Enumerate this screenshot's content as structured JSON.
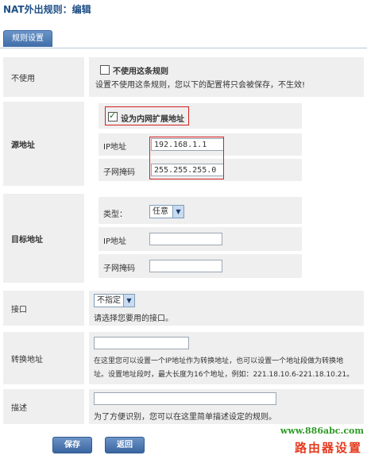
{
  "page": {
    "title": "NAT外出规则：编辑"
  },
  "tab": {
    "label": "规则设置"
  },
  "disable": {
    "label": "不使用",
    "checkbox_label": "不使用这条规则",
    "hint": "设置不使用这条规则，您以下的配置将只会被保存，不生效!"
  },
  "source": {
    "label": "源地址",
    "checkbox_label": "设为内网扩展地址",
    "ip_label": "IP地址",
    "ip_value": "192.168.1.1",
    "mask_label": "子网掩码",
    "mask_value": "255.255.255.0"
  },
  "target": {
    "label": "目标地址",
    "type_label": "类型：",
    "type_value": "任意",
    "ip_label": "IP地址",
    "mask_label": "子网掩码"
  },
  "iface": {
    "label": "接口",
    "select_value": "不指定",
    "hint": "请选择您要用的接口。"
  },
  "translate": {
    "label": "转换地址",
    "hint_line1": "在这里您可以设置一个IP地址作为转换地址，也可以设置一个地址段做为转换地",
    "hint_line2": "址。设置地址段时，最大长度为16个地址，例如：221.18.10.6-221.18.10.21。"
  },
  "desc": {
    "label": "描述",
    "hint": "为了方便识别，您可以在这里简单描述设定的规则。"
  },
  "buttons": {
    "save": "保存",
    "back": "返回"
  },
  "watermark": {
    "url": "www.886abc.com",
    "text": "路由器设置"
  },
  "colors": {
    "accent": "#3f6ea8",
    "highlight": "#d62020",
    "row_bg": "#efefef"
  }
}
